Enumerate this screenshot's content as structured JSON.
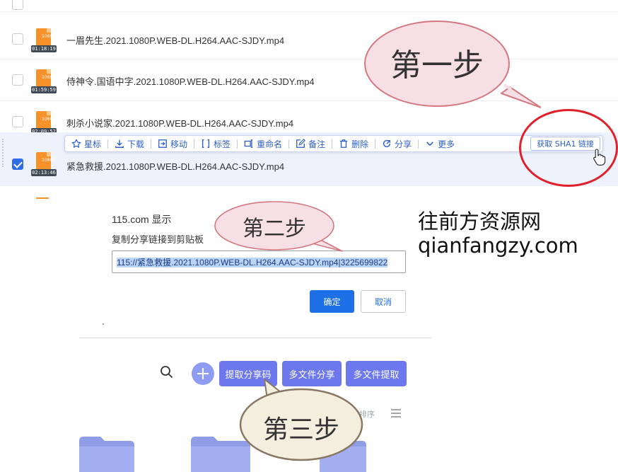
{
  "files": [
    {
      "name": "一眉先生.2021.1080P.WEB-DL.H264.AAC-SJDY.mp4",
      "resolution": "1080P",
      "duration": "01:18:19",
      "checked": false
    },
    {
      "name": "侍神令.国语中字.2021.1080P.WEB-DL.H264.AAC-SJDY.mp4",
      "resolution": "1080P",
      "duration": "01:59:59",
      "checked": false
    },
    {
      "name": "刺杀小说家.2021.1080P.WEB-DL.H264.AAC-SJDY.mp4",
      "resolution": "1080P",
      "duration": "02:09:52",
      "checked": false
    },
    {
      "name": "紧急救援.2021.1080P.WEB-DL.H264.AAC-SJDY.mp4",
      "resolution": "1080P",
      "duration": "02:13:46",
      "checked": true
    }
  ],
  "toolbar": {
    "star": "星标",
    "download": "下载",
    "move": "移动",
    "tag": "标签",
    "rename": "重命名",
    "note": "备注",
    "delete": "删除",
    "share": "分享",
    "more": "更多",
    "sha1": "获取 SHA1 链接"
  },
  "annotations": {
    "step1": "第一步",
    "step2": "第二步",
    "step3": "第三步"
  },
  "dialog": {
    "title": "115.com 显示",
    "message": "复制分享链接到剪贴板",
    "input_value": "115://紧急救援.2021.1080P.WEB-DL.H264.AAC-SJDY.mp4|3225699822",
    "ok": "确定",
    "cancel": "取消"
  },
  "watermark": {
    "line1": "往前方资源网",
    "line2": "qianfangzy.com"
  },
  "bottom_bar": {
    "extract_code": "提取分享码",
    "multi_share": "多文件分享",
    "multi_extract": "多文件提取",
    "sort_label": "排序"
  },
  "colors": {
    "accent_blue": "#1f6fe6",
    "purple_button": "#6d78ee",
    "annotation_red": "#e0202a",
    "bubble_pink": "#f7dfe6",
    "bubble_beige": "#f4eedf"
  }
}
